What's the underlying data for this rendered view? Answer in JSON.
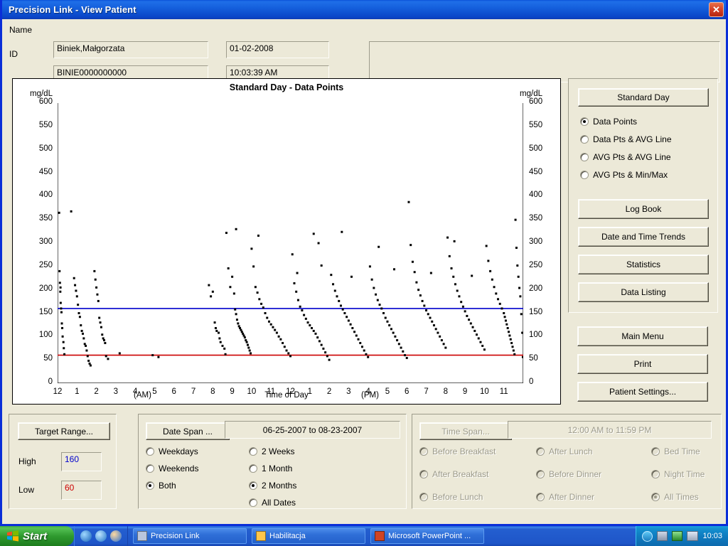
{
  "window": {
    "title": "Precision Link - View Patient",
    "close_label": "✕"
  },
  "patient": {
    "name_label": "Name",
    "name_value": "Biniek,Małgorzata",
    "id_label": "ID",
    "id_value": "BINIE0000000000",
    "date_value": "01-02-2008",
    "time_value": "10:03:39 AM",
    "notes_value": ""
  },
  "chart": {
    "title": "Standard Day - Data Points",
    "unit_left": "mg/dL",
    "unit_right": "mg/dL",
    "xlabel": "Time of Day",
    "am_label": "(AM)",
    "pm_label": "(PM)"
  },
  "chart_data": {
    "type": "scatter",
    "title": "Standard Day - Data Points",
    "xlabel": "Time of Day",
    "ylabel": "mg/dL",
    "xlim": [
      0,
      24
    ],
    "ylim": [
      0,
      600
    ],
    "ytick_values": [
      0,
      50,
      100,
      150,
      200,
      250,
      300,
      350,
      400,
      450,
      500,
      550,
      600
    ],
    "ytick_labels": [
      "0",
      "50",
      "100",
      "150",
      "200",
      "250",
      "300",
      "350",
      "400",
      "450",
      "500",
      "550",
      "600"
    ],
    "xtick_values": [
      0,
      1,
      2,
      3,
      4,
      5,
      6,
      7,
      8,
      9,
      10,
      11,
      12,
      13,
      14,
      15,
      16,
      17,
      18,
      19,
      20,
      21,
      22,
      23
    ],
    "xtick_labels": [
      "12",
      "1",
      "2",
      "3",
      "4",
      "5",
      "6",
      "7",
      "8",
      "9",
      "10",
      "11",
      "12",
      "1",
      "2",
      "3",
      "4",
      "5",
      "6",
      "7",
      "8",
      "9",
      "10",
      "11"
    ],
    "grid": false,
    "legend": null,
    "reference_lines": [
      {
        "name": "high-target-line",
        "value": 160,
        "color": "#0000cc",
        "label": "High 160"
      },
      {
        "name": "low-target-line",
        "value": 60,
        "color": "#cc0000",
        "label": "Low 60"
      }
    ],
    "marker": {
      "shape": "square",
      "size": 3,
      "color": "#000000"
    },
    "points": [
      [
        0.08,
        365
      ],
      [
        0.1,
        240
      ],
      [
        0.12,
        215
      ],
      [
        0.14,
        196
      ],
      [
        0.15,
        205
      ],
      [
        0.16,
        172
      ],
      [
        0.18,
        160
      ],
      [
        0.2,
        152
      ],
      [
        0.22,
        128
      ],
      [
        0.24,
        118
      ],
      [
        0.26,
        100
      ],
      [
        0.3,
        88
      ],
      [
        0.32,
        75
      ],
      [
        0.35,
        62
      ],
      [
        0.7,
        368
      ],
      [
        0.85,
        225
      ],
      [
        0.9,
        210
      ],
      [
        0.95,
        198
      ],
      [
        1.0,
        186
      ],
      [
        1.05,
        168
      ],
      [
        1.1,
        150
      ],
      [
        1.15,
        142
      ],
      [
        1.2,
        124
      ],
      [
        1.25,
        112
      ],
      [
        1.3,
        106
      ],
      [
        1.35,
        96
      ],
      [
        1.4,
        84
      ],
      [
        1.45,
        80
      ],
      [
        1.5,
        70
      ],
      [
        1.55,
        58
      ],
      [
        1.6,
        48
      ],
      [
        1.65,
        42
      ],
      [
        1.7,
        38
      ],
      [
        1.9,
        240
      ],
      [
        1.95,
        222
      ],
      [
        2.0,
        205
      ],
      [
        2.05,
        190
      ],
      [
        2.1,
        176
      ],
      [
        2.15,
        140
      ],
      [
        2.2,
        130
      ],
      [
        2.25,
        120
      ],
      [
        2.3,
        104
      ],
      [
        2.35,
        96
      ],
      [
        2.4,
        92
      ],
      [
        2.45,
        86
      ],
      [
        2.5,
        58
      ],
      [
        2.6,
        52
      ],
      [
        3.2,
        64
      ],
      [
        7.8,
        210
      ],
      [
        7.9,
        186
      ],
      [
        8.0,
        196
      ],
      [
        8.1,
        130
      ],
      [
        8.15,
        118
      ],
      [
        8.2,
        112
      ],
      [
        8.3,
        108
      ],
      [
        8.35,
        96
      ],
      [
        8.4,
        88
      ],
      [
        8.5,
        80
      ],
      [
        8.6,
        74
      ],
      [
        8.65,
        62
      ],
      [
        8.7,
        322
      ],
      [
        8.8,
        246
      ],
      [
        8.9,
        206
      ],
      [
        9.0,
        228
      ],
      [
        9.1,
        192
      ],
      [
        9.15,
        158
      ],
      [
        9.2,
        148
      ],
      [
        9.25,
        136
      ],
      [
        9.3,
        128
      ],
      [
        9.35,
        122
      ],
      [
        9.4,
        118
      ],
      [
        9.45,
        114
      ],
      [
        9.5,
        110
      ],
      [
        9.55,
        106
      ],
      [
        9.6,
        102
      ],
      [
        9.65,
        98
      ],
      [
        9.7,
        92
      ],
      [
        9.75,
        88
      ],
      [
        9.8,
        82
      ],
      [
        9.85,
        76
      ],
      [
        9.9,
        70
      ],
      [
        9.95,
        64
      ],
      [
        10.0,
        288
      ],
      [
        10.1,
        250
      ],
      [
        10.2,
        206
      ],
      [
        10.3,
        194
      ],
      [
        10.4,
        180
      ],
      [
        10.5,
        170
      ],
      [
        10.6,
        162
      ],
      [
        10.7,
        150
      ],
      [
        10.8,
        140
      ],
      [
        10.9,
        132
      ],
      [
        11.0,
        126
      ],
      [
        11.1,
        120
      ],
      [
        11.2,
        114
      ],
      [
        11.3,
        108
      ],
      [
        11.4,
        100
      ],
      [
        11.5,
        94
      ],
      [
        11.6,
        86
      ],
      [
        11.7,
        78
      ],
      [
        11.8,
        70
      ],
      [
        11.9,
        64
      ],
      [
        12.0,
        58
      ],
      [
        12.1,
        276
      ],
      [
        12.2,
        214
      ],
      [
        12.3,
        196
      ],
      [
        12.4,
        178
      ],
      [
        12.5,
        164
      ],
      [
        12.6,
        156
      ],
      [
        12.7,
        146
      ],
      [
        12.8,
        138
      ],
      [
        12.9,
        130
      ],
      [
        13.0,
        124
      ],
      [
        13.1,
        118
      ],
      [
        13.2,
        112
      ],
      [
        13.3,
        106
      ],
      [
        13.4,
        98
      ],
      [
        13.5,
        90
      ],
      [
        13.6,
        82
      ],
      [
        13.7,
        74
      ],
      [
        13.8,
        66
      ],
      [
        13.9,
        58
      ],
      [
        14.0,
        50
      ],
      [
        13.2,
        320
      ],
      [
        13.45,
        300
      ],
      [
        13.6,
        252
      ],
      [
        14.1,
        232
      ],
      [
        14.2,
        212
      ],
      [
        14.3,
        198
      ],
      [
        14.4,
        186
      ],
      [
        14.5,
        176
      ],
      [
        14.6,
        166
      ],
      [
        14.7,
        158
      ],
      [
        14.8,
        150
      ],
      [
        14.9,
        142
      ],
      [
        15.0,
        134
      ],
      [
        15.1,
        126
      ],
      [
        15.2,
        118
      ],
      [
        15.3,
        110
      ],
      [
        15.4,
        102
      ],
      [
        15.5,
        94
      ],
      [
        15.6,
        86
      ],
      [
        15.7,
        78
      ],
      [
        15.8,
        70
      ],
      [
        15.9,
        62
      ],
      [
        16.0,
        56
      ],
      [
        16.1,
        250
      ],
      [
        16.2,
        222
      ],
      [
        16.3,
        204
      ],
      [
        16.4,
        190
      ],
      [
        16.5,
        178
      ],
      [
        16.6,
        168
      ],
      [
        16.7,
        160
      ],
      [
        16.8,
        150
      ],
      [
        16.9,
        140
      ],
      [
        17.0,
        132
      ],
      [
        17.1,
        124
      ],
      [
        17.2,
        116
      ],
      [
        17.3,
        108
      ],
      [
        17.4,
        100
      ],
      [
        17.5,
        92
      ],
      [
        17.6,
        84
      ],
      [
        17.7,
        76
      ],
      [
        17.8,
        68
      ],
      [
        17.9,
        60
      ],
      [
        18.0,
        54
      ],
      [
        18.1,
        388
      ],
      [
        18.2,
        296
      ],
      [
        18.3,
        260
      ],
      [
        18.4,
        238
      ],
      [
        18.5,
        216
      ],
      [
        18.6,
        200
      ],
      [
        18.7,
        188
      ],
      [
        18.8,
        176
      ],
      [
        18.9,
        166
      ],
      [
        19.0,
        156
      ],
      [
        19.1,
        148
      ],
      [
        19.2,
        140
      ],
      [
        19.3,
        132
      ],
      [
        19.4,
        124
      ],
      [
        19.5,
        116
      ],
      [
        19.6,
        108
      ],
      [
        19.7,
        100
      ],
      [
        19.8,
        92
      ],
      [
        19.9,
        84
      ],
      [
        20.0,
        76
      ],
      [
        20.1,
        312
      ],
      [
        20.2,
        272
      ],
      [
        20.3,
        246
      ],
      [
        20.4,
        228
      ],
      [
        20.5,
        212
      ],
      [
        20.6,
        198
      ],
      [
        20.7,
        186
      ],
      [
        20.8,
        174
      ],
      [
        20.9,
        164
      ],
      [
        21.0,
        154
      ],
      [
        21.1,
        144
      ],
      [
        21.2,
        136
      ],
      [
        21.3,
        128
      ],
      [
        21.4,
        120
      ],
      [
        21.5,
        112
      ],
      [
        21.6,
        104
      ],
      [
        21.7,
        96
      ],
      [
        21.8,
        88
      ],
      [
        21.9,
        80
      ],
      [
        22.0,
        72
      ],
      [
        22.1,
        294
      ],
      [
        22.2,
        262
      ],
      [
        22.3,
        240
      ],
      [
        22.4,
        222
      ],
      [
        22.5,
        206
      ],
      [
        22.6,
        192
      ],
      [
        22.7,
        180
      ],
      [
        22.8,
        170
      ],
      [
        22.9,
        160
      ],
      [
        23.0,
        150
      ],
      [
        23.05,
        142
      ],
      [
        23.1,
        134
      ],
      [
        23.15,
        126
      ],
      [
        23.2,
        118
      ],
      [
        23.25,
        110
      ],
      [
        23.3,
        102
      ],
      [
        23.35,
        94
      ],
      [
        23.4,
        86
      ],
      [
        23.45,
        78
      ],
      [
        23.5,
        70
      ],
      [
        23.55,
        62
      ],
      [
        23.6,
        350
      ],
      [
        23.65,
        290
      ],
      [
        23.7,
        252
      ],
      [
        23.75,
        228
      ],
      [
        23.8,
        204
      ],
      [
        23.85,
        186
      ],
      [
        23.9,
        148
      ],
      [
        23.95,
        108
      ],
      [
        23.98,
        56
      ],
      [
        4.9,
        60
      ],
      [
        5.2,
        56
      ],
      [
        9.2,
        330
      ],
      [
        10.35,
        316
      ],
      [
        14.65,
        324
      ],
      [
        16.55,
        292
      ],
      [
        20.45,
        304
      ],
      [
        12.35,
        236
      ],
      [
        15.15,
        228
      ],
      [
        17.35,
        244
      ],
      [
        19.25,
        236
      ],
      [
        21.35,
        230
      ]
    ]
  },
  "side_panel": {
    "standard_day_label": "Standard Day",
    "view_modes": [
      {
        "label": "Data Points",
        "selected": true
      },
      {
        "label": "Data Pts & AVG Line",
        "selected": false
      },
      {
        "label": "AVG Pts & AVG Line",
        "selected": false
      },
      {
        "label": "AVG Pts & Min/Max",
        "selected": false
      }
    ],
    "buttons": [
      {
        "name": "log-book-button",
        "label": "Log Book"
      },
      {
        "name": "date-time-trends-button",
        "label": "Date and Time Trends"
      },
      {
        "name": "statistics-button",
        "label": "Statistics"
      },
      {
        "name": "data-listing-button",
        "label": "Data Listing"
      }
    ],
    "nav_buttons": [
      {
        "name": "main-menu-button",
        "label": "Main Menu"
      },
      {
        "name": "print-button",
        "label": "Print"
      },
      {
        "name": "patient-settings-button",
        "label": "Patient Settings..."
      }
    ]
  },
  "target_range": {
    "button_label": "Target Range...",
    "high_label": "High",
    "high_value": "160",
    "high_color": "#0000cc",
    "low_label": "Low",
    "low_value": "60",
    "low_color": "#cc0000"
  },
  "date_span": {
    "button_label": "Date Span ...",
    "range_text": "06-25-2007 to  08-23-2007",
    "day_types": [
      {
        "label": "Weekdays",
        "selected": false
      },
      {
        "label": "Weekends",
        "selected": false
      },
      {
        "label": "Both",
        "selected": true
      }
    ],
    "spans": [
      {
        "label": "2 Weeks",
        "selected": false
      },
      {
        "label": "1 Month",
        "selected": false
      },
      {
        "label": "2 Months",
        "selected": true
      },
      {
        "label": "All Dates",
        "selected": false
      }
    ]
  },
  "time_span": {
    "button_label": "Time Span...",
    "range_text": "12:00 AM to  11:59 PM",
    "disabled": true,
    "options": [
      {
        "label": "Before Breakfast",
        "selected": false
      },
      {
        "label": "After Breakfast",
        "selected": false
      },
      {
        "label": "Before Lunch",
        "selected": false
      },
      {
        "label": "After Lunch",
        "selected": false
      },
      {
        "label": "Before Dinner",
        "selected": false
      },
      {
        "label": "After Dinner",
        "selected": false
      },
      {
        "label": "Bed Time",
        "selected": false
      },
      {
        "label": "Night Time",
        "selected": false
      },
      {
        "label": "All Times",
        "selected": true
      }
    ]
  },
  "taskbar": {
    "start_label": "Start",
    "tasks": [
      {
        "name": "taskbar-item-precision-link",
        "label": "Precision Link"
      },
      {
        "name": "taskbar-item-habilitacja",
        "label": "Habilitacja"
      },
      {
        "name": "taskbar-item-powerpoint",
        "label": "Microsoft PowerPoint ..."
      }
    ],
    "clock": "10:03"
  }
}
